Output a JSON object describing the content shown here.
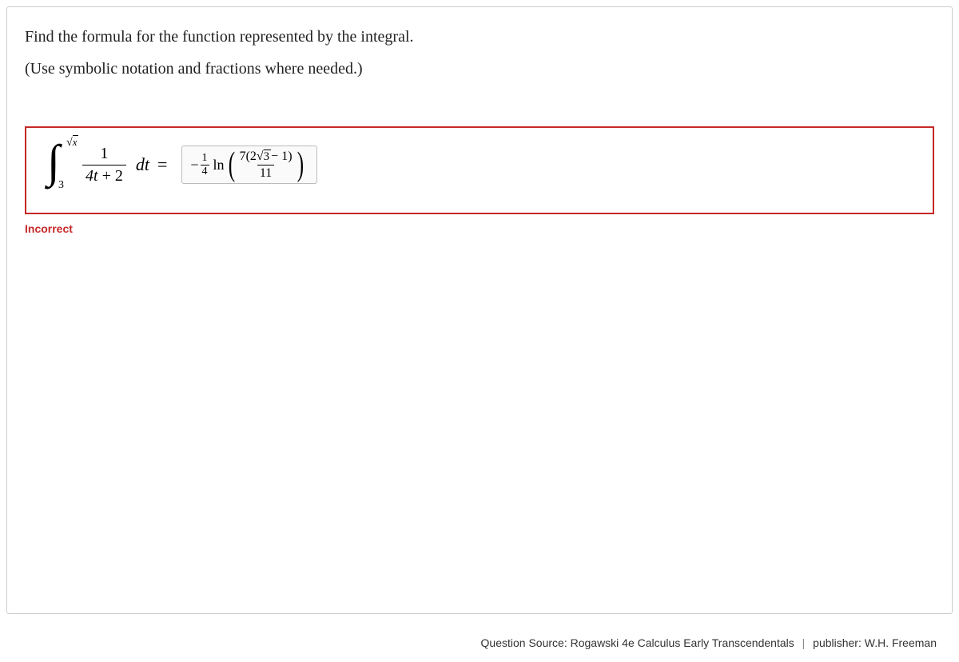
{
  "question": {
    "prompt": "Find the formula for the function represented by the integral.",
    "hint": "(Use symbolic notation and fractions where needed.)"
  },
  "integral": {
    "upper_radicand": "x",
    "lower": "3",
    "integrand_num": "1",
    "integrand_den": "4t + 2",
    "dt": "dt",
    "equals": "="
  },
  "answer": {
    "minus": "−",
    "coef_num": "1",
    "coef_den": "4",
    "ln": "ln",
    "inner_num_coef": "7",
    "inner_num_paren_left": "(",
    "inner_num_2": "2",
    "inner_num_sqrt": "3",
    "inner_num_minus": " − 1",
    "inner_num_paren_right": ")",
    "inner_den": "11"
  },
  "feedback": "Incorrect",
  "footer": {
    "source_label": "Question Source:",
    "source_value": "Rogawski 4e Calculus Early Transcendentals",
    "publisher_label": "publisher:",
    "publisher_value": "W.H. Freeman"
  }
}
